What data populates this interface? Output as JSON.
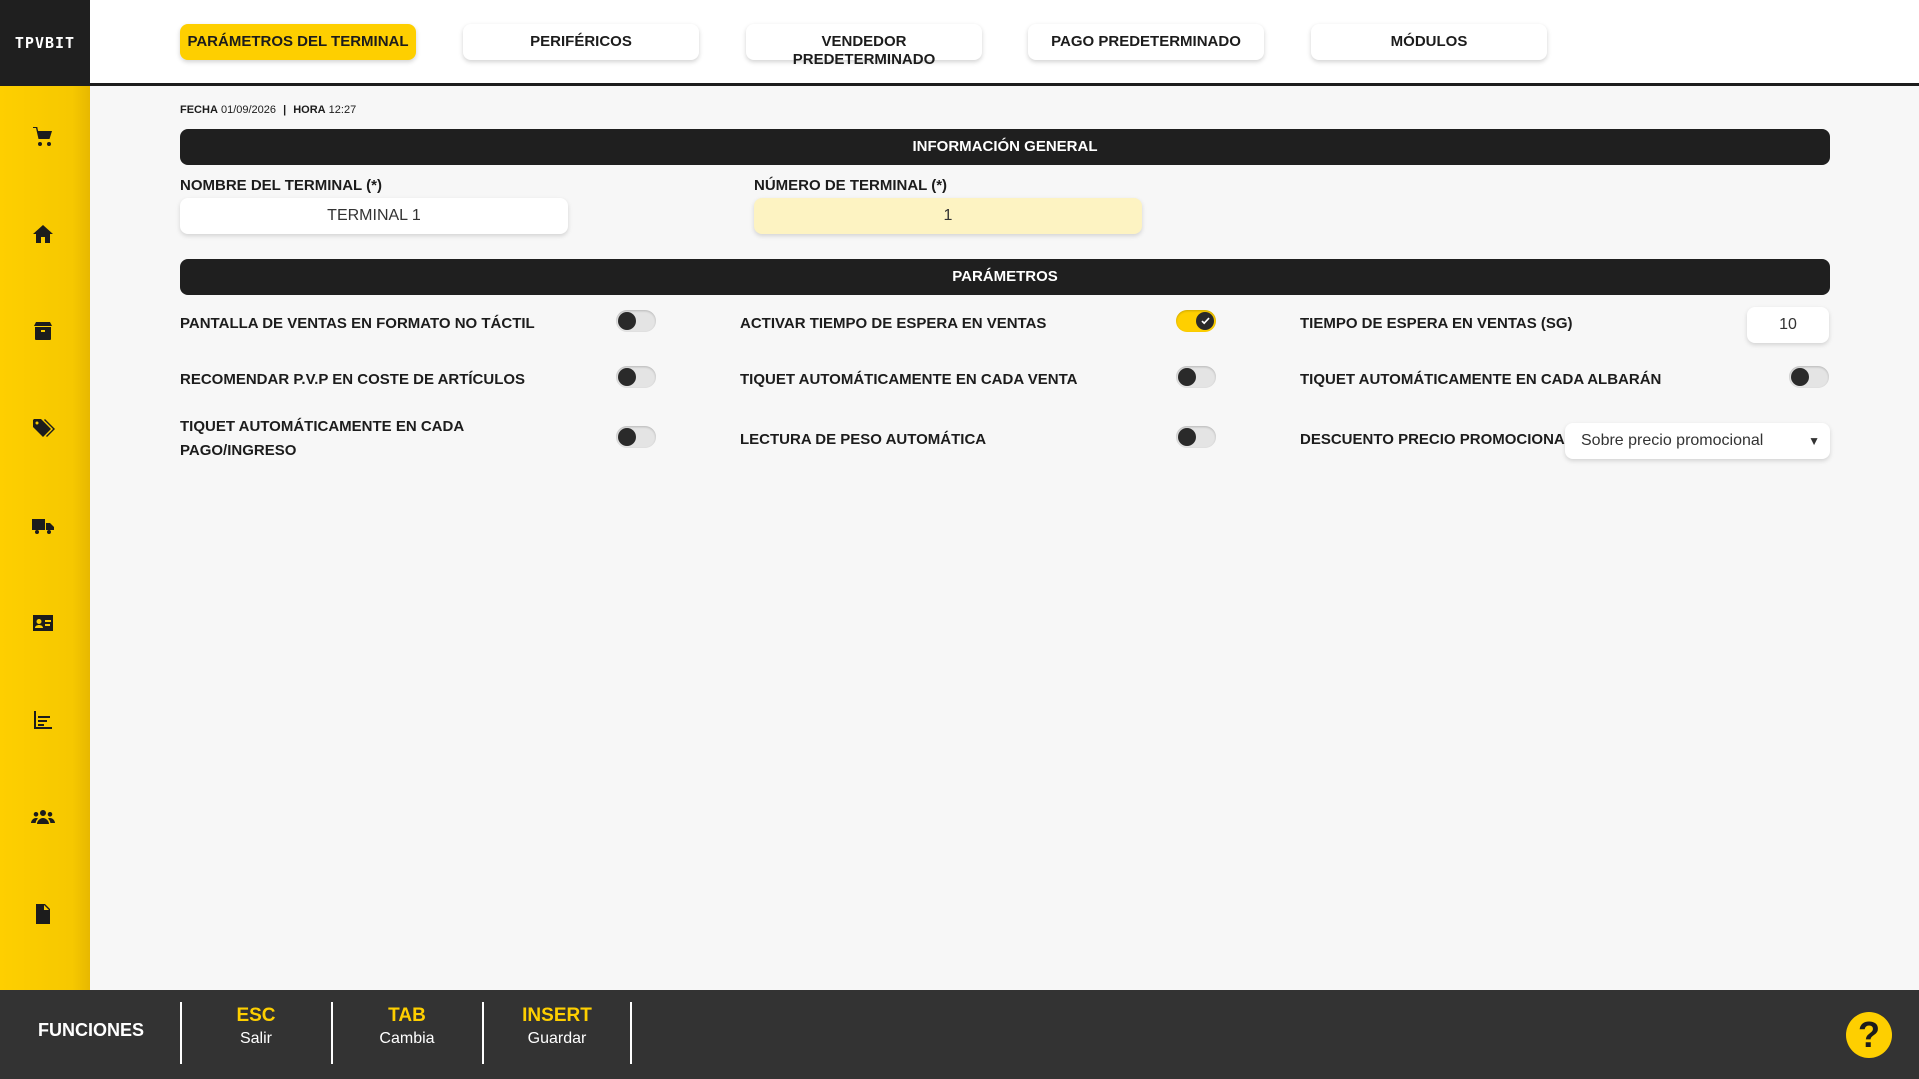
{
  "app": {
    "logo_text": "TPVBIT"
  },
  "tabs": [
    {
      "label": "PARÁMETROS DEL TERMINAL",
      "active": true
    },
    {
      "label": "PERIFÉRICOS"
    },
    {
      "label": "VENDEDOR PREDETERMINADO"
    },
    {
      "label": "PAGO PREDETERMINADO"
    },
    {
      "label": "MÓDULOS"
    }
  ],
  "sidebar": {
    "icons": [
      "cart-icon",
      "home-icon",
      "box-icon",
      "tags-icon",
      "truck-icon",
      "id-card-icon",
      "chart-icon",
      "users-icon",
      "document-icon"
    ]
  },
  "datetime": {
    "date_label": "FECHA",
    "date": "01/09/2026",
    "sep": "|",
    "time_label": "HORA",
    "time": "12:27"
  },
  "general": {
    "title": "INFORMACIÓN GENERAL",
    "name_label": "NOMBRE DEL TERMINAL (*)",
    "name_value": "TERMINAL 1",
    "number_label": "NÚMERO DE TERMINAL (*)",
    "number_value": "1"
  },
  "params": {
    "title": "PARÁMETROS",
    "items": [
      {
        "label": "PANTALLA DE VENTAS EN FORMATO NO TÁCTIL",
        "on": false
      },
      {
        "label": "ACTIVAR TIEMPO DE ESPERA EN VENTAS",
        "on": true
      },
      {
        "label": "TIEMPO DE ESPERA EN VENTAS (SG)",
        "value": "10"
      },
      {
        "label": "RECOMENDAR P.V.P EN COSTE DE ARTÍCULOS",
        "on": false
      },
      {
        "label": "TIQUET AUTOMÁTICAMENTE EN CADA VENTA",
        "on": false
      },
      {
        "label": "TIQUET AUTOMÁTICAMENTE EN CADA ALBARÁN",
        "on": false
      },
      {
        "label": "TIQUET AUTOMÁTICAMENTE EN CADA PAGO/INGRESO",
        "on": false
      },
      {
        "label": "LECTURA DE PESO AUTOMÁTICA",
        "on": false
      },
      {
        "label": "DESCUENTO PRECIO PROMOCIONAL",
        "select": "Sobre precio promocional"
      }
    ]
  },
  "footer": {
    "title": "FUNCIONES",
    "keys": [
      {
        "key": "ESC",
        "action": "Salir"
      },
      {
        "key": "TAB",
        "action": "Cambia"
      },
      {
        "key": "INSERT",
        "action": "Guardar"
      }
    ],
    "help": "?"
  },
  "colors": {
    "accent": "#fecf00",
    "dark": "#1f1f1f",
    "footer": "#333333"
  }
}
